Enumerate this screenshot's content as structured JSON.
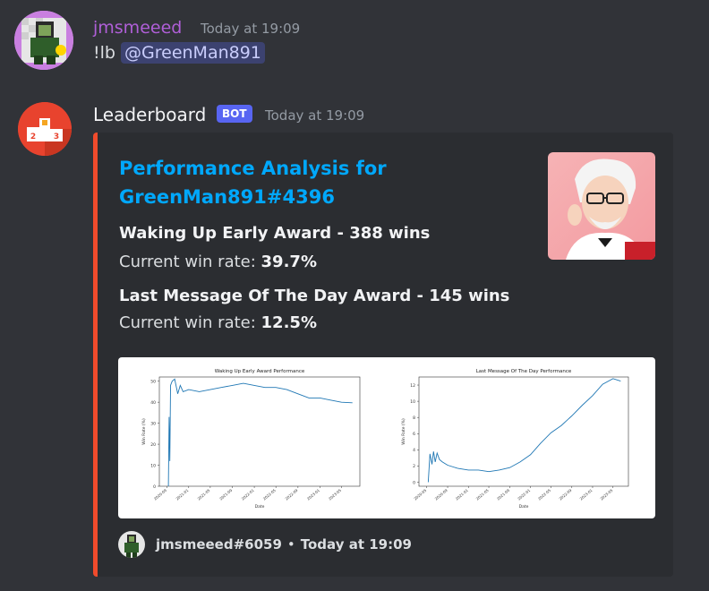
{
  "message1": {
    "username": "jmsmeeed",
    "username_color": "#b05fd8",
    "timestamp": "Today at 19:09",
    "text": "!lb",
    "mention": "@GreenMan891"
  },
  "message2": {
    "username": "Leaderboard",
    "bot_tag": "BOT",
    "timestamp": "Today at 19:09"
  },
  "embed": {
    "accent_color": "#f04b2c",
    "title_line1": "Performance Analysis for",
    "title_line2": "GreenMan891#4396",
    "fields": [
      {
        "name": "Waking Up Early Award - 388 wins",
        "label": "Current win rate: ",
        "value": "39.7%"
      },
      {
        "name": "Last Message Of The Day Award - 145 wins",
        "label": "Current win rate: ",
        "value": "12.5%"
      }
    ],
    "footer": {
      "author": "jmsmeeed#6059",
      "separator": "•",
      "timestamp": "Today at 19:09"
    }
  },
  "chart_data": [
    {
      "type": "line",
      "title": "Waking Up Early Award Performance",
      "xlabel": "Date",
      "ylabel": "Win Rate (%)",
      "ylim": [
        0,
        52
      ],
      "yticks": [
        0,
        10,
        20,
        30,
        40,
        50
      ],
      "xticks": [
        "2020-09",
        "2021-01",
        "2021-05",
        "2021-09",
        "2022-01",
        "2022-05",
        "2022-09",
        "2023-01",
        "2023-05"
      ],
      "x": [
        "2020-09-10",
        "2020-09-14",
        "2020-09-18",
        "2020-09-22",
        "2020-10-01",
        "2020-10-15",
        "2020-11-01",
        "2020-11-15",
        "2020-12-01",
        "2021-01-01",
        "2021-03-01",
        "2021-05-01",
        "2021-07-01",
        "2021-09-01",
        "2021-11-01",
        "2022-01-01",
        "2022-03-01",
        "2022-05-01",
        "2022-07-01",
        "2022-09-01",
        "2022-11-01",
        "2023-01-01",
        "2023-03-01",
        "2023-05-01",
        "2023-07-01"
      ],
      "y": [
        0,
        33,
        12,
        48,
        50,
        51,
        44,
        48,
        45,
        46,
        45,
        46,
        47,
        48,
        49,
        48,
        47,
        47,
        46,
        44,
        42,
        42,
        41,
        40,
        39.7
      ]
    },
    {
      "type": "line",
      "title": "Last Message Of The Day Performance",
      "xlabel": "Date",
      "ylabel": "Win Rate (%)",
      "ylim": [
        -0.5,
        13
      ],
      "yticks": [
        0,
        2,
        4,
        6,
        8,
        10,
        12
      ],
      "xticks": [
        "2020-05",
        "2020-09",
        "2021-01",
        "2021-05",
        "2021-09",
        "2022-01",
        "2022-05",
        "2022-09",
        "2023-01",
        "2023-05"
      ],
      "x": [
        "2020-05-10",
        "2020-05-20",
        "2020-06-01",
        "2020-06-10",
        "2020-06-20",
        "2020-07-01",
        "2020-07-15",
        "2020-08-01",
        "2020-09-01",
        "2020-11-01",
        "2021-01-01",
        "2021-03-01",
        "2021-05-01",
        "2021-07-01",
        "2021-09-01",
        "2021-11-01",
        "2022-01-01",
        "2022-03-01",
        "2022-05-01",
        "2022-07-01",
        "2022-09-01",
        "2022-11-01",
        "2023-01-01",
        "2023-03-01",
        "2023-05-01",
        "2023-06-15"
      ],
      "y": [
        0,
        3.5,
        2.2,
        3.8,
        2.5,
        3.6,
        2.8,
        2.5,
        2.1,
        1.7,
        1.5,
        1.5,
        1.3,
        1.5,
        1.8,
        2.5,
        3.4,
        4.8,
        6.1,
        7.0,
        8.2,
        9.5,
        10.7,
        12.1,
        12.8,
        12.5
      ]
    }
  ]
}
